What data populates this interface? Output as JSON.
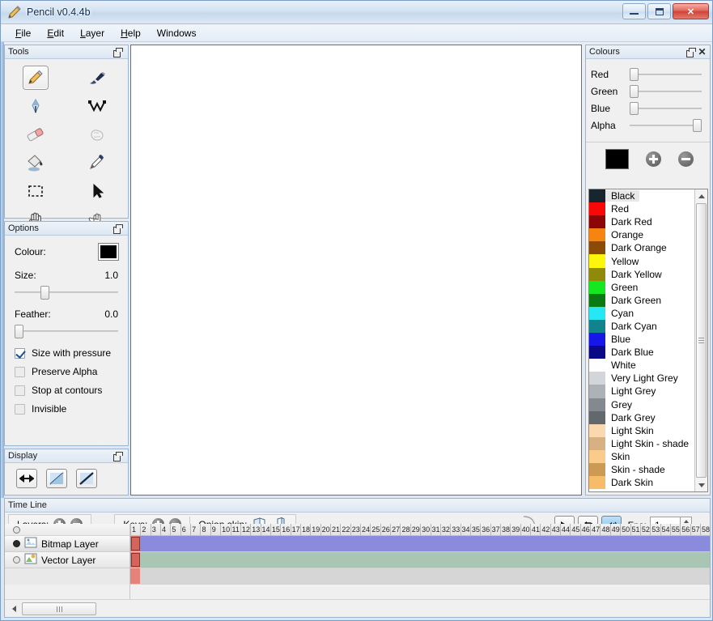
{
  "window": {
    "title": "Pencil v0.4.4b",
    "icon": "pencil-icon",
    "buttons": {
      "minimize": "–",
      "restore": "❐",
      "close": "✕"
    }
  },
  "menubar": {
    "items": [
      {
        "label": "File",
        "mnemonic": "F"
      },
      {
        "label": "Edit",
        "mnemonic": "E"
      },
      {
        "label": "Layer",
        "mnemonic": "L"
      },
      {
        "label": "Help",
        "mnemonic": "H"
      },
      {
        "label": "Windows",
        "mnemonic": ""
      }
    ]
  },
  "tools_panel": {
    "title": "Tools",
    "tools": [
      {
        "name": "pencil-tool",
        "selected": true
      },
      {
        "name": "brush-tool",
        "selected": false
      },
      {
        "name": "pen-tool",
        "selected": false
      },
      {
        "name": "polyline-tool",
        "selected": false
      },
      {
        "name": "eraser-tool",
        "selected": false
      },
      {
        "name": "smudge-tool",
        "selected": false
      },
      {
        "name": "bucket-fill-tool",
        "selected": false
      },
      {
        "name": "eyedropper-tool",
        "selected": false
      },
      {
        "name": "select-tool",
        "selected": false
      },
      {
        "name": "move-tool",
        "selected": false
      },
      {
        "name": "hand-tool",
        "selected": false
      },
      {
        "name": "zoom-tool",
        "selected": false
      }
    ]
  },
  "options_panel": {
    "title": "Options",
    "colour_label": "Colour:",
    "colour_value": "#000000",
    "size_label": "Size:",
    "size_value": "1.0",
    "size_percent": 25,
    "feather_label": "Feather:",
    "feather_value": "0.0",
    "feather_percent": 0,
    "checkboxes": [
      {
        "label": "Size with pressure",
        "checked": true
      },
      {
        "label": "Preserve Alpha",
        "checked": false
      },
      {
        "label": "Stop at contours",
        "checked": false
      },
      {
        "label": "Invisible",
        "checked": false
      }
    ]
  },
  "display_panel": {
    "title": "Display",
    "buttons": [
      {
        "name": "flip-horizontal-button"
      },
      {
        "name": "angle-mirror-button"
      },
      {
        "name": "angle-line-button"
      }
    ]
  },
  "colours_panel": {
    "title": "Colours",
    "sliders": [
      {
        "label": "Red",
        "percent": 0
      },
      {
        "label": "Green",
        "percent": 0
      },
      {
        "label": "Blue",
        "percent": 0
      },
      {
        "label": "Alpha",
        "percent": 100
      }
    ],
    "current_colour": "#000000",
    "add_label": "+",
    "remove_label": "−",
    "list": [
      {
        "name": "Black",
        "hex": "#18242e",
        "selected": true
      },
      {
        "name": "Red",
        "hex": "#fb0707"
      },
      {
        "name": "Dark Red",
        "hex": "#8e0505"
      },
      {
        "name": "Orange",
        "hex": "#f58410"
      },
      {
        "name": "Dark Orange",
        "hex": "#8b4a06"
      },
      {
        "name": "Yellow",
        "hex": "#fcf60a"
      },
      {
        "name": "Dark Yellow",
        "hex": "#8f8a08"
      },
      {
        "name": "Green",
        "hex": "#13e821"
      },
      {
        "name": "Dark Green",
        "hex": "#0a7a12"
      },
      {
        "name": "Cyan",
        "hex": "#25e8f4"
      },
      {
        "name": "Dark Cyan",
        "hex": "#11838c"
      },
      {
        "name": "Blue",
        "hex": "#1616e8"
      },
      {
        "name": "Dark Blue",
        "hex": "#0a0a86"
      },
      {
        "name": "White",
        "hex": "#fefefe"
      },
      {
        "name": "Very Light Grey",
        "hex": "#d2d6da"
      },
      {
        "name": "Light Grey",
        "hex": "#adb2b7"
      },
      {
        "name": "Grey",
        "hex": "#84898f"
      },
      {
        "name": "Dark Grey",
        "hex": "#63686d"
      },
      {
        "name": "Light Skin",
        "hex": "#fbd9b0"
      },
      {
        "name": "Light Skin - shade",
        "hex": "#d8b183"
      },
      {
        "name": "Skin",
        "hex": "#fbcb8c"
      },
      {
        "name": "Skin - shade",
        "hex": "#cc9a52"
      },
      {
        "name": "Dark Skin",
        "hex": "#f7bc6a"
      }
    ]
  },
  "timeline": {
    "title": "Time Line",
    "layers_label": "Layers:",
    "keys_label": "Keys:",
    "onion_label": "Onion skin:",
    "fps_label": "Fps:",
    "fps_value": "1",
    "controls": [
      {
        "name": "play-button",
        "active": false
      },
      {
        "name": "loop-button",
        "active": false
      },
      {
        "name": "sound-button",
        "active": true
      }
    ],
    "layers": [
      {
        "name": "Bitmap Layer",
        "icon": "bitmap-layer-icon",
        "visible": true,
        "selected": true,
        "track_colour": "#8b8bdd"
      },
      {
        "name": "Vector Layer",
        "icon": "vector-layer-icon",
        "visible": false,
        "selected": false,
        "track_colour": "#a8c6b3"
      }
    ],
    "frame_start": 1,
    "frame_end": 58,
    "current_frame": 1,
    "frame_numbers": [
      1,
      2,
      3,
      4,
      5,
      6,
      7,
      8,
      9,
      10,
      11,
      12,
      13,
      14,
      15,
      16,
      17,
      18,
      19,
      20,
      21,
      22,
      23,
      24,
      25,
      26,
      27,
      28,
      29,
      30,
      31,
      32,
      33,
      34,
      35,
      36,
      37,
      38,
      39,
      40,
      41,
      42,
      43,
      44,
      45,
      46,
      47,
      48,
      49,
      50,
      51,
      52,
      53,
      54,
      55,
      56,
      57,
      58
    ]
  }
}
